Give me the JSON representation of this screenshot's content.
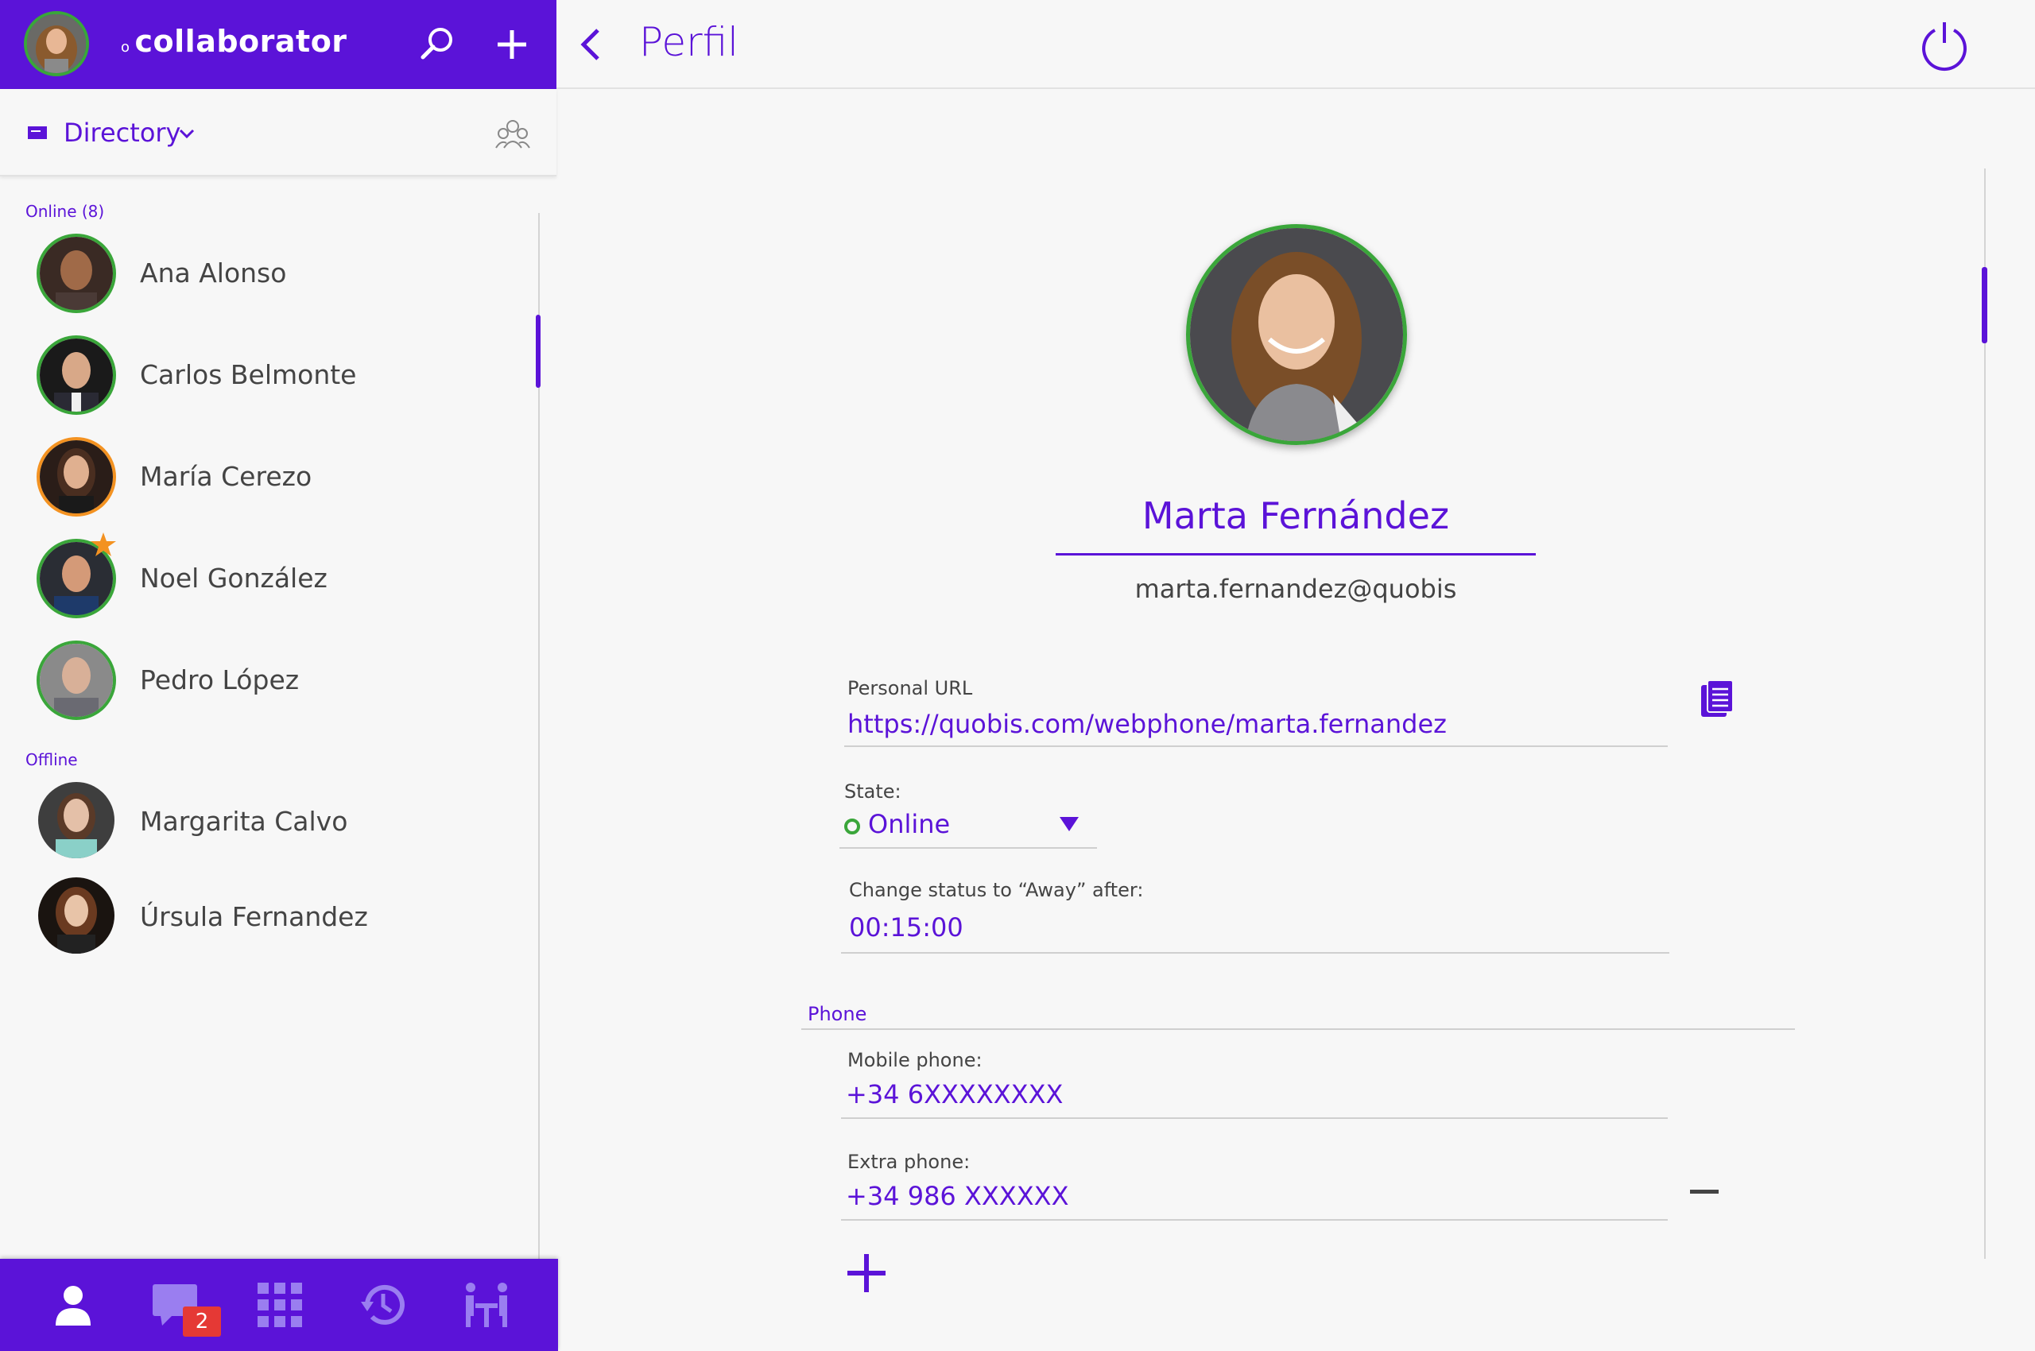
{
  "app": {
    "logo_text": "collaborator",
    "logo_dot": "o",
    "brand_color": "#5b13d8",
    "online_color": "#3aa63a",
    "away_color": "#f39221",
    "badge_color": "#e53935"
  },
  "topbar": {
    "search_icon": "search-icon",
    "add_icon": "plus-icon"
  },
  "directory": {
    "label": "Directory",
    "icon": "directory-icon",
    "group_icon": "groups-icon"
  },
  "contacts": {
    "online_label": "Online (8)",
    "offline_label": "Offline",
    "online": [
      {
        "name": "Ana Alonso",
        "status": "online"
      },
      {
        "name": "Carlos Belmonte",
        "status": "online"
      },
      {
        "name": "María Cerezo",
        "status": "away"
      },
      {
        "name": "Noel González",
        "status": "online",
        "favorite": true
      },
      {
        "name": "Pedro López",
        "status": "online"
      }
    ],
    "offline": [
      {
        "name": "Margarita Calvo"
      },
      {
        "name": "Úrsula Fernandez"
      }
    ]
  },
  "bottom_nav": {
    "tabs": [
      "contacts-icon",
      "chat-icon",
      "dialpad-icon",
      "history-icon",
      "meeting-icon"
    ],
    "chat_badge": "2"
  },
  "header": {
    "title": "Perfil",
    "back_icon": "back-arrow-icon",
    "power_icon": "power-icon"
  },
  "profile": {
    "name": "Marta Fernández",
    "username": "marta.fernandez@quobis",
    "personal_url_label": "Personal URL",
    "personal_url": "https://quobis.com/webphone/marta.fernandez",
    "state_label": "State:",
    "state_value": "Online",
    "away_label": "Change status to “Away” after:",
    "away_value": "00:15:00",
    "phone_section": "Phone",
    "mobile_label": "Mobile phone:",
    "mobile_value": "+34 6XXXXXXXX",
    "extra_label": "Extra phone:",
    "extra_value": "+34 986 XXXXXX"
  }
}
